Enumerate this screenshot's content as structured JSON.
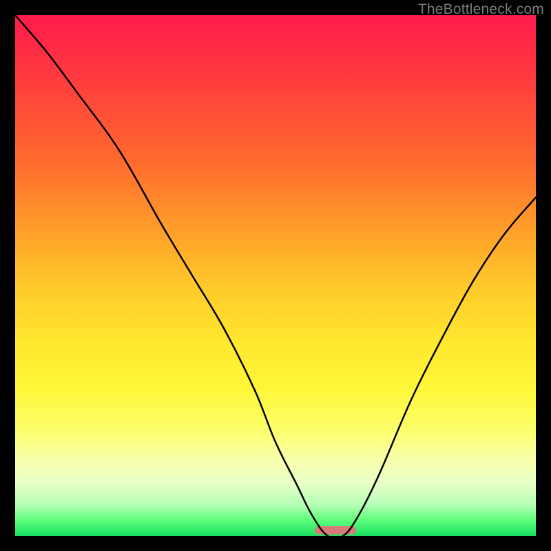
{
  "attribution": "TheBottleneck.com",
  "chart_data": {
    "type": "line",
    "title": "",
    "xlabel": "",
    "ylabel": "",
    "xlim": [
      0,
      100
    ],
    "ylim": [
      0,
      100
    ],
    "series": [
      {
        "name": "bottleneck-curve",
        "x": [
          0,
          6,
          12,
          20,
          28,
          34,
          40,
          46,
          50,
          54,
          57,
          60,
          63,
          66,
          70,
          76,
          82,
          88,
          94,
          100
        ],
        "values": [
          100,
          93,
          85,
          74,
          60,
          50,
          40,
          28,
          18,
          10,
          4,
          0,
          0,
          4,
          12,
          26,
          38,
          49,
          58,
          65
        ]
      }
    ],
    "annotations": [
      {
        "name": "optimal-marker",
        "x_center": 61.5,
        "width_pct": 8,
        "height_pct": 1.6
      }
    ],
    "background_gradient": {
      "stops": [
        {
          "pos": 0,
          "color": "#ff1a4b"
        },
        {
          "pos": 28,
          "color": "#ff6a2f"
        },
        {
          "pos": 52,
          "color": "#ffc92a"
        },
        {
          "pos": 72,
          "color": "#fff73a"
        },
        {
          "pos": 90,
          "color": "#e6ffc7"
        },
        {
          "pos": 100,
          "color": "#18e060"
        }
      ]
    }
  }
}
